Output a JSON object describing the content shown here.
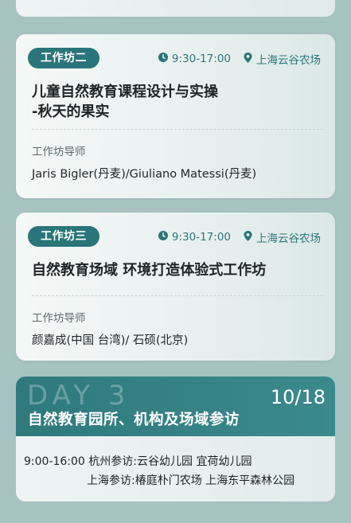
{
  "workshop2": {
    "badge": "工作坊二",
    "time": "9:30-17:00",
    "location": "上海云谷农场",
    "title_line1": "儿童自然教育课程设计与实操",
    "title_line2": "-秋天的果实",
    "mentor_label": "工作坊导师",
    "mentors": "Jaris Bigler(丹麦)/Giuliano Matessi(丹麦)"
  },
  "workshop3": {
    "badge": "工作坊三",
    "time": "9:30-17:00",
    "location": "上海云谷农场",
    "title": "自然教育场域 环境打造体验式工作坊",
    "mentor_label": "工作坊导师",
    "mentors": "颜嘉成(中国 台湾)/ 石硕(北京)"
  },
  "day3": {
    "bg_text": "DAY 3",
    "date": "10/18",
    "title": "自然教育园所、机构及场域参访",
    "time": "9:00-16:00",
    "line1": "杭州参访:云谷幼儿园  宜荷幼儿园",
    "line2": "上海参访:椿庭朴门农场  上海东平森林公园"
  },
  "icons": {
    "clock": "clock-icon",
    "pin": "location-pin-icon"
  },
  "colors": {
    "accent": "#2a7579",
    "background": "#a6c2c1"
  }
}
